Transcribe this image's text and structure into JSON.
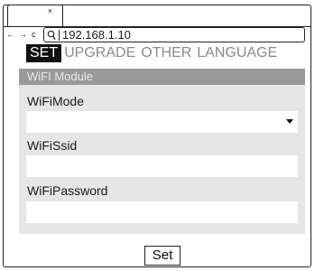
{
  "browser": {
    "tab_close": "×",
    "nav_back": "←",
    "nav_forward": "→",
    "nav_reload": "c",
    "url": "192.168.1.10"
  },
  "menu": {
    "items": [
      {
        "label": "SET",
        "active": true
      },
      {
        "label": "UPGRADE",
        "active": false
      },
      {
        "label": "OTHER",
        "active": false
      },
      {
        "label": "LANGUAGE",
        "active": false
      }
    ]
  },
  "panel": {
    "header": "WiFI Module",
    "fields": {
      "mode_label": "WiFiMode",
      "mode_value": "",
      "ssid_label": "WiFiSsid",
      "ssid_value": "",
      "password_label": "WiFiPassword",
      "password_value": ""
    }
  },
  "actions": {
    "set_label": "Set"
  },
  "colors": {
    "active_menu_bg": "#111111",
    "inactive_menu_text": "#8a8a8a",
    "panel_bg": "#e6e6e6",
    "panel_header_bg": "#9a9a9a"
  },
  "icons": {
    "address_search": "search-icon",
    "select_arrow": "chevron-down-icon"
  }
}
